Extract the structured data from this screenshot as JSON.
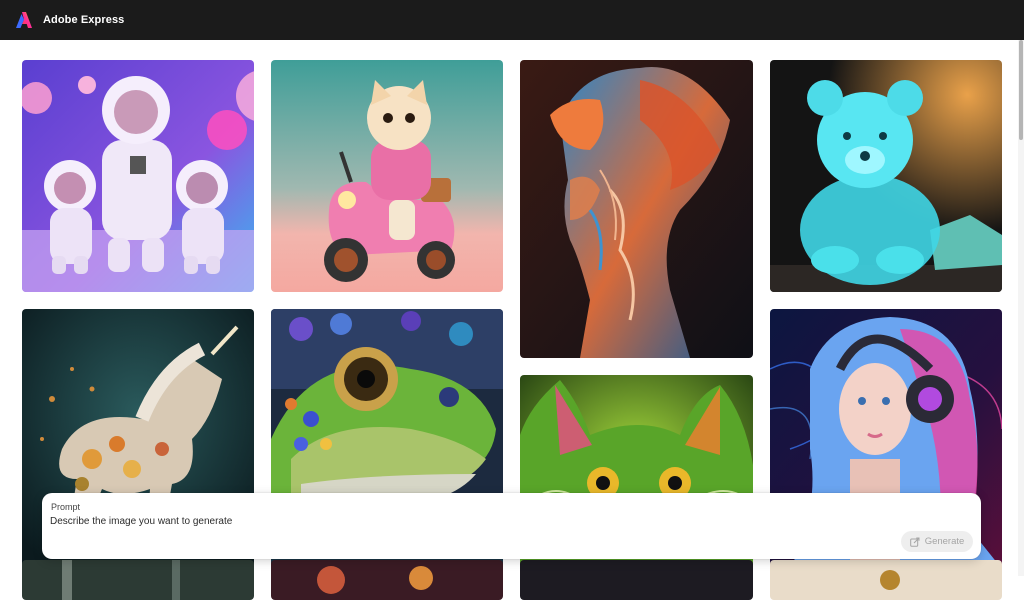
{
  "header": {
    "app_title": "Adobe Express",
    "logo_icon": "adobe-express-logo-icon",
    "background": "#1b1b1b"
  },
  "gallery": {
    "images": [
      {
        "subject": "astronaut-family"
      },
      {
        "subject": "cat-on-scooter"
      },
      {
        "subject": "wavy-paper-face"
      },
      {
        "subject": "crystal-bear"
      },
      {
        "subject": "floral-unicorn"
      },
      {
        "subject": "colorful-lizard"
      },
      {
        "subject": "green-cat"
      },
      {
        "subject": "girl-with-headphones"
      }
    ]
  },
  "prompt": {
    "label": "Prompt",
    "placeholder": "Describe the image you want to generate",
    "value": "",
    "generate_label": "Generate",
    "generate_icon": "generate-icon"
  }
}
